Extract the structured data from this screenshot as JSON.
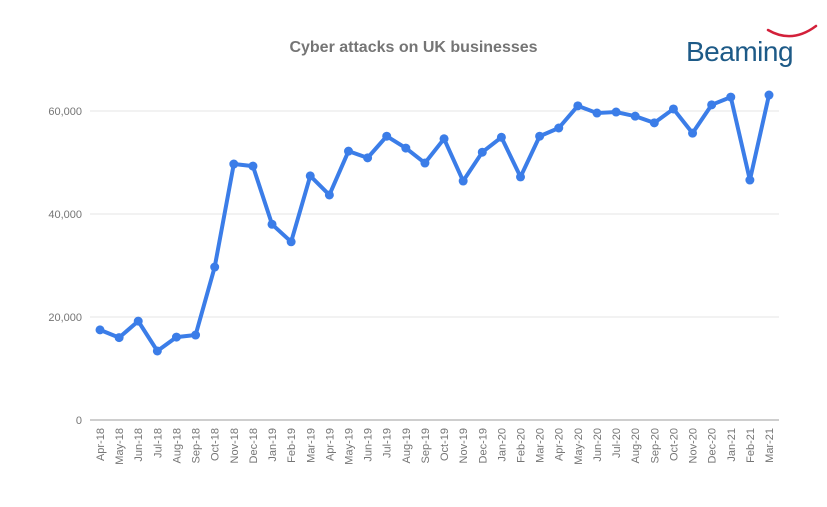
{
  "logo": {
    "text": "Beaming",
    "text_color": "#1d5a87",
    "swoosh_color": "#d3203a"
  },
  "chart_data": {
    "type": "line",
    "title": "Cyber attacks on UK businesses",
    "xlabel": "",
    "ylabel": "",
    "ylim": [
      0,
      70000
    ],
    "yticks": [
      0,
      20000,
      40000,
      60000
    ],
    "ytick_labels": [
      "0",
      "20,000",
      "40,000",
      "60,000"
    ],
    "grid": true,
    "legend": "none",
    "series_color": "#3b7de8",
    "categories": [
      "Apr-18",
      "May-18",
      "Jun-18",
      "Jul-18",
      "Aug-18",
      "Sep-18",
      "Oct-18",
      "Nov-18",
      "Dec-18",
      "Jan-19",
      "Feb-19",
      "Mar-19",
      "Apr-19",
      "May-19",
      "Jun-19",
      "Jul-19",
      "Aug-19",
      "Sep-19",
      "Oct-19",
      "Nov-19",
      "Dec-19",
      "Jan-20",
      "Feb-20",
      "Mar-20",
      "Apr-20",
      "May-20",
      "Jun-20",
      "Jul-20",
      "Aug-20",
      "Sep-20",
      "Oct-20",
      "Nov-20",
      "Dec-20",
      "Jan-21",
      "Feb-21",
      "Mar-21"
    ],
    "series": [
      {
        "name": "Cyber attacks",
        "values": [
          17500,
          16000,
          19200,
          13400,
          16100,
          16500,
          29700,
          49700,
          49300,
          38000,
          34600,
          47400,
          43700,
          52200,
          50900,
          55100,
          52800,
          49900,
          54600,
          46400,
          52000,
          54900,
          47200,
          55100,
          56700,
          61000,
          59600,
          59800,
          59000,
          57700,
          60400,
          55700,
          61200,
          62700,
          46600,
          63100
        ]
      }
    ]
  }
}
